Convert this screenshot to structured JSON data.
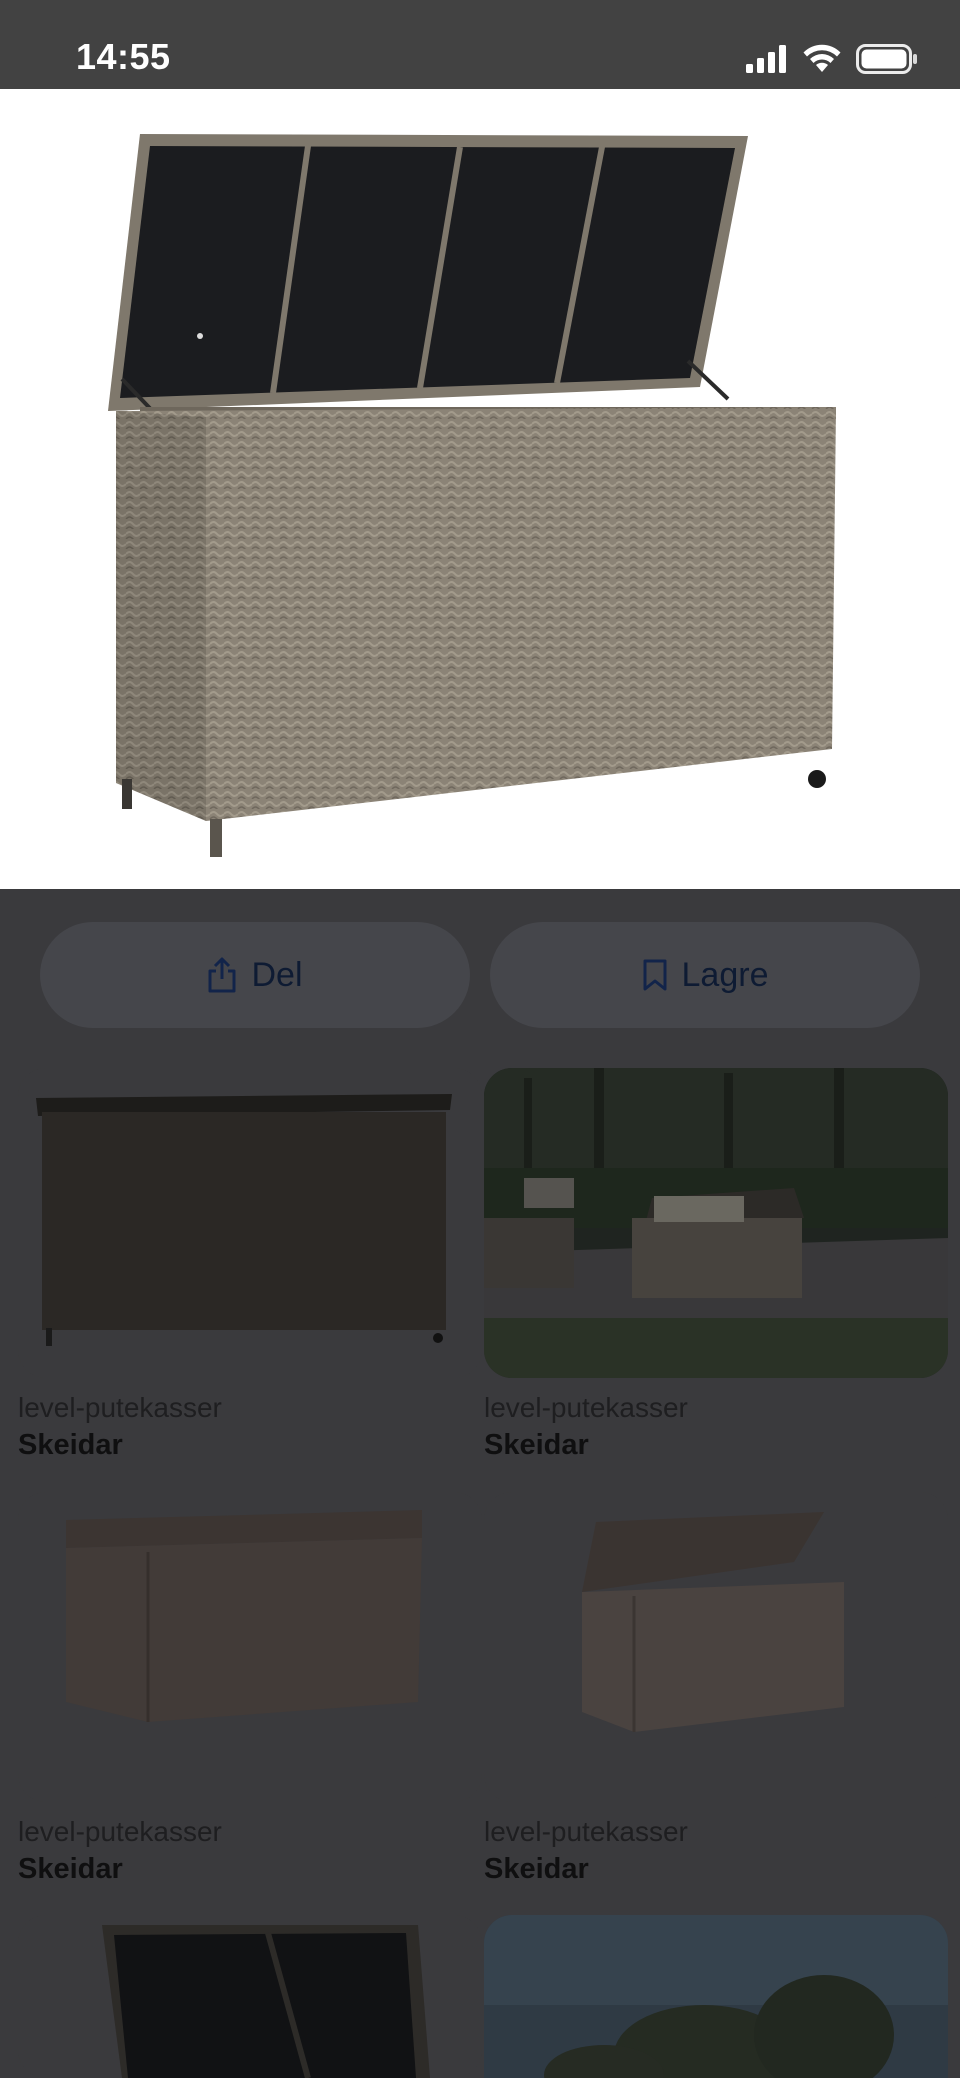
{
  "status_bar": {
    "time": "14:55",
    "icons": [
      "cellular-signal-icon",
      "wifi-icon",
      "battery-icon"
    ]
  },
  "hero": {
    "icon": "storage-box-image"
  },
  "actions": {
    "share_label": "Del",
    "save_label": "Lagre"
  },
  "results": [
    {
      "source": "level-putekasser",
      "title": "Skeidar"
    },
    {
      "source": "level-putekasser",
      "title": "Skeidar"
    },
    {
      "source": "level-putekasser",
      "title": "Skeidar"
    },
    {
      "source": "level-putekasser",
      "title": "Skeidar"
    }
  ],
  "colors": {
    "overlay": "#3a3a3d",
    "button_bg": "#45464b",
    "button_text": "#0e1b33",
    "status_bar": "#424242"
  }
}
